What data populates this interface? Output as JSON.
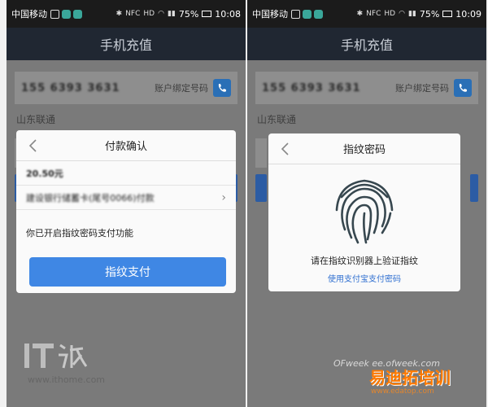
{
  "left": {
    "status": {
      "carrier": "中国移动",
      "battery": "75%",
      "time": "10:08",
      "net_labels": [
        "NFC",
        "HD"
      ]
    },
    "title": "手机充值",
    "phone_number": "155 6393 3631",
    "phone_hint": "账户绑定号码",
    "carrier": "山东联通",
    "dialog": {
      "title": "付款确认",
      "amount": "20.50元",
      "card_label": "建设银行储蓄卡(尾号0066)付款",
      "notice": "你已开启指纹密码支付功能",
      "button": "指纹支付"
    }
  },
  "right": {
    "status": {
      "carrier": "中国移动",
      "battery": "75%",
      "time": "10:09",
      "net_labels": [
        "NFC",
        "HD"
      ]
    },
    "title": "手机充值",
    "phone_number": "155 6393 3631",
    "phone_hint": "账户绑定号码",
    "carrier": "山东联通",
    "dialog": {
      "title": "指纹密码",
      "hint": "请在指纹识别器上验证指纹",
      "link": "使用支付宝支付密码"
    }
  },
  "watermark": {
    "it_url": "www.ithome.com",
    "brand": "易迪拓培训",
    "brand_sub": "www.edatop.com",
    "ofweek": "OFweek ee.ofweek.com"
  },
  "colors": {
    "accent_blue": "#3f87e4",
    "header_bg": "#202732",
    "link_blue": "#2f6fd0"
  },
  "icons": [
    "back-icon",
    "chevron-right-icon",
    "contact-icon",
    "fingerprint-icon"
  ]
}
